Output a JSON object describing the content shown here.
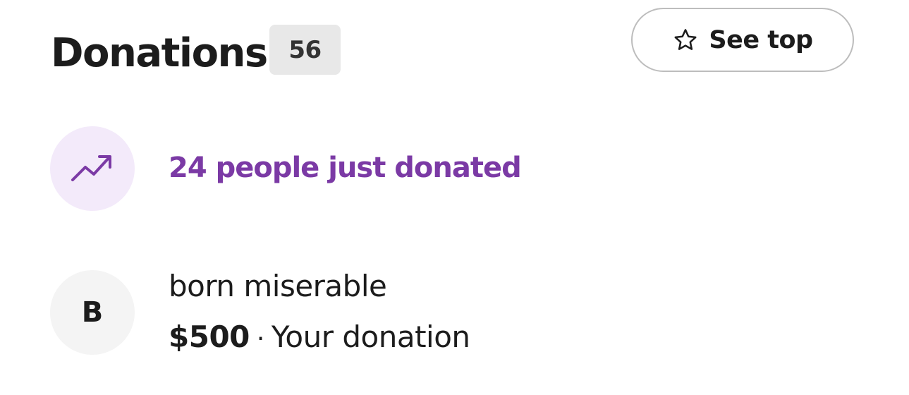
{
  "header": {
    "title": "Donations",
    "count": "56"
  },
  "see_top_button": {
    "label": "See top",
    "icon": "star-outline-icon"
  },
  "trending": {
    "icon": "trending-up-icon",
    "text": "24 people just donated",
    "accent_color": "#7b3aa5"
  },
  "donations": [
    {
      "avatar_initial": "B",
      "name": "born miserable",
      "amount": "$500",
      "separator": "·",
      "note": "Your donation"
    }
  ]
}
